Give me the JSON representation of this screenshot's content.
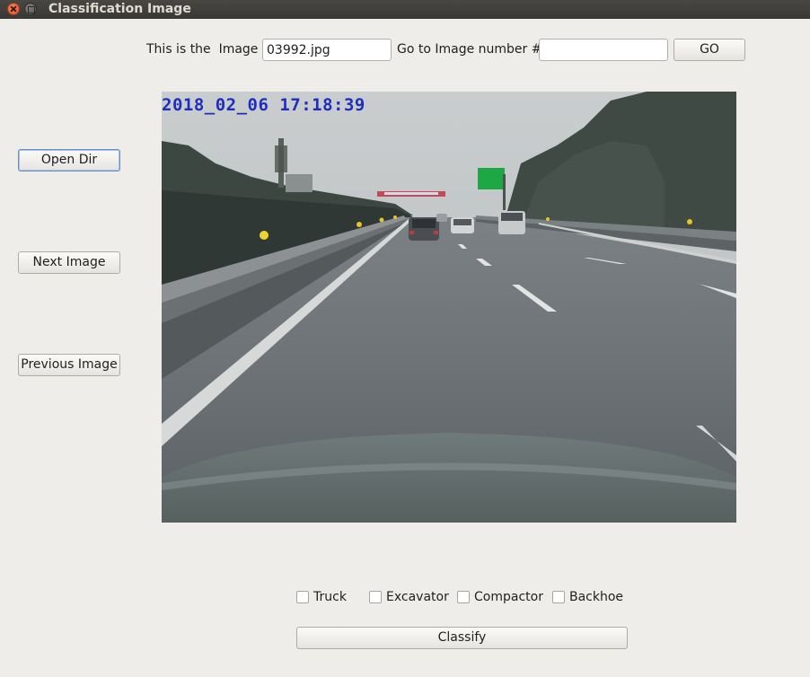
{
  "window": {
    "title": "Classification Image"
  },
  "header": {
    "image_label": "This is the  Image",
    "image_name": "03992.jpg",
    "goto_label": "Go to Image number #",
    "goto_value": "",
    "go_button": "GO"
  },
  "sidebar": {
    "open_dir": "Open Dir",
    "next_image": "Next Image",
    "previous_image": "Previous Image"
  },
  "image": {
    "timestamp": "2018_02_06 17:18:39"
  },
  "classes": [
    {
      "label": "Truck",
      "checked": false
    },
    {
      "label": "Excavator",
      "checked": false
    },
    {
      "label": "Compactor",
      "checked": false
    },
    {
      "label": "Backhoe",
      "checked": false
    }
  ],
  "classify_button": "Classify"
}
